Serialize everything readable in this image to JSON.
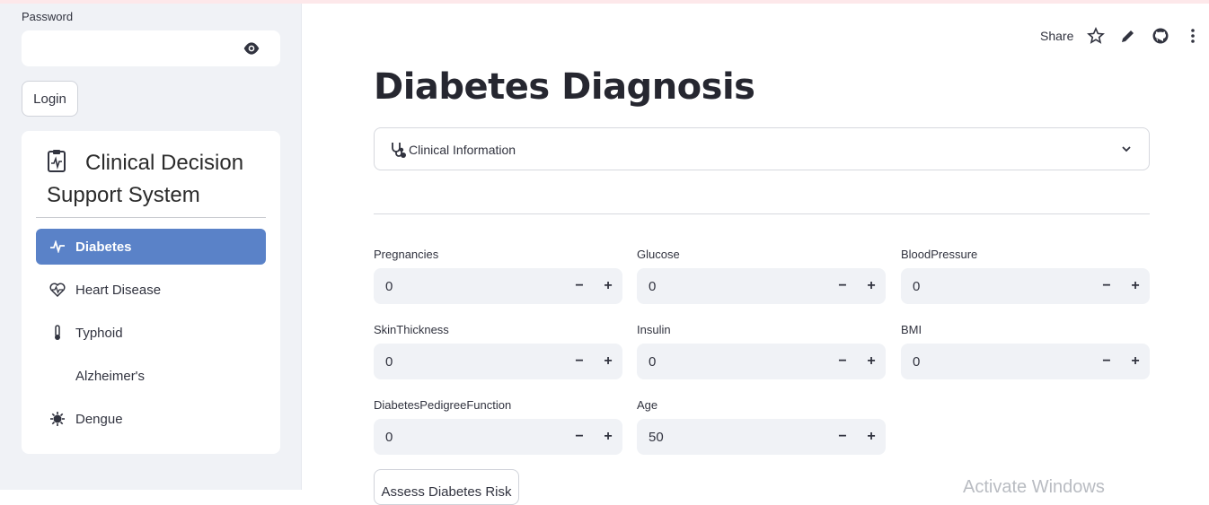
{
  "sidebar": {
    "password_label": "Password",
    "login_label": "Login",
    "menu_title": "Clinical Decision Support System",
    "items": [
      {
        "label": "Diabetes",
        "icon": "activity-icon",
        "active": true
      },
      {
        "label": "Heart Disease",
        "icon": "heart-pulse-icon",
        "active": false
      },
      {
        "label": "Typhoid",
        "icon": "thermometer-icon",
        "active": false
      },
      {
        "label": "Alzheimer's",
        "icon": "",
        "active": false
      },
      {
        "label": "Dengue",
        "icon": "virus-icon",
        "active": false
      }
    ],
    "active_color": "#5a82c8"
  },
  "toolbar": {
    "share_label": "Share",
    "icons": [
      "star-icon",
      "pencil-icon",
      "github-icon",
      "kebab-menu-icon"
    ]
  },
  "main": {
    "title": "Diabetes Diagnosis",
    "expander_label": "Clinical Information",
    "fields": [
      {
        "label": "Pregnancies",
        "value": "0"
      },
      {
        "label": "Glucose",
        "value": "0"
      },
      {
        "label": "BloodPressure",
        "value": "0"
      },
      {
        "label": "SkinThickness",
        "value": "0"
      },
      {
        "label": "Insulin",
        "value": "0"
      },
      {
        "label": "BMI",
        "value": "0"
      },
      {
        "label": "DiabetesPedigreeFunction",
        "value": "0"
      },
      {
        "label": "Age",
        "value": "50"
      }
    ],
    "assess_label": "Assess Diabetes Risk"
  },
  "watermark": "Activate Windows"
}
